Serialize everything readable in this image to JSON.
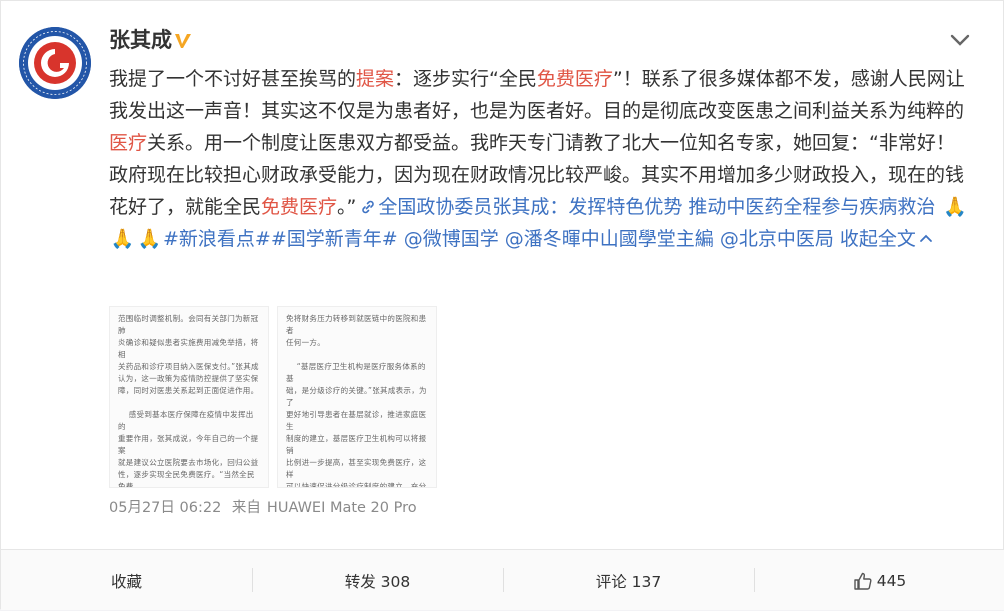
{
  "post": {
    "username": "张其成",
    "verified_icon": "verified-v-icon",
    "menu_icon": "chevron-down-icon",
    "text": {
      "p1": "我提了一个不讨好甚至挨骂的",
      "kw_proposal": "提案",
      "p2": "：逐步实行“全民",
      "kw_free_medical_1": "免费医疗",
      "p3": "”！联系了很多媒体都不发，感谢人民网让我发出这一声音！其实这不仅是为患者好，也是为医者好。目的是彻底改变医患之间利益关系为纯粹的",
      "kw_medical": "医疗",
      "p4": "关系。用一个制度让医患双方都受益。我昨天专门请教了北大一位知名专家，她回复：“非常好！政府现在比较担心财政承受能力，因为现在财政情况比较严峻。其实不用增加多少财政投入，现在的钱花好了，就能全民",
      "kw_free_medical_2": "免费医疗",
      "p5": "。”",
      "link_icon": "link-icon",
      "link_text": "全国政协委员张其成：发挥特色优势 推动中医药全程参与疾病救治",
      "emoji": "🙏",
      "hashtag_1": "#新浪看点#",
      "hashtag_2": "#国学新青年#",
      "mention_1": "@微博国学",
      "mention_2": "@潘冬暉中山國學堂主編",
      "mention_3": "@北京中医局",
      "collapse_label": "收起全文",
      "collapse_icon": "chevron-up-icon"
    },
    "images": {
      "left_text": "范围临时调整机制。会同有关部门为新冠肺\n炎确诊和疑似患者实施费用减免举措，将相\n关药品和诊疗项目纳入医保支付。”张其成\n认为，这一政策为疫情防控提供了坚实保\n障，同时对医患关系起到正面促进作用。\n\n    感受到基本医疗保障在疫情中发挥出的\n重要作用，张其成说，今年自己的一个提案\n就是建议公立医院要去市场化，回归公益\n性，逐步实现全民免费医疗。“当然全民免费\n医疗，并不意味着是完全免费，也不意味着\n完全由财政负担，而是一种保障水平更高、\n个人支付比重较低的全民医疗保险制度，”他",
      "right_text": "免将财务压力转移到就医链中的医院和患者\n任何一方。\n\n    “基层医疗卫生机构是医疗服务体系的基\n础，是分级诊疗的关键。”张其成表示，为了\n更好地引导患者在基层就诊，推进家庭医生\n制度的建立，基层医疗卫生机构可以将报销\n比例进一步提高，甚至实现免费医疗，这样\n可以快速促进分级诊疗制度的建立，充分发\n挥基层医疗卫生机构的“健康守门人”作用。\n\n    他还建议在各级公立中医医院进行试\n点，充分发挥中医药“简、便、验、廉”的优"
    },
    "meta": {
      "date": "05月27日 06:22",
      "source_prefix": "来自",
      "source": "HUAWEI Mate 20 Pro"
    }
  },
  "actions": {
    "favorite_label": "收藏",
    "repost_label": "转发 308",
    "comment_label": "评论 137",
    "like_icon": "thumbs-up-icon",
    "like_count": "445"
  },
  "colors": {
    "keyword": "#e05545",
    "link": "#3e72c2",
    "meta": "#8a8a8a"
  }
}
